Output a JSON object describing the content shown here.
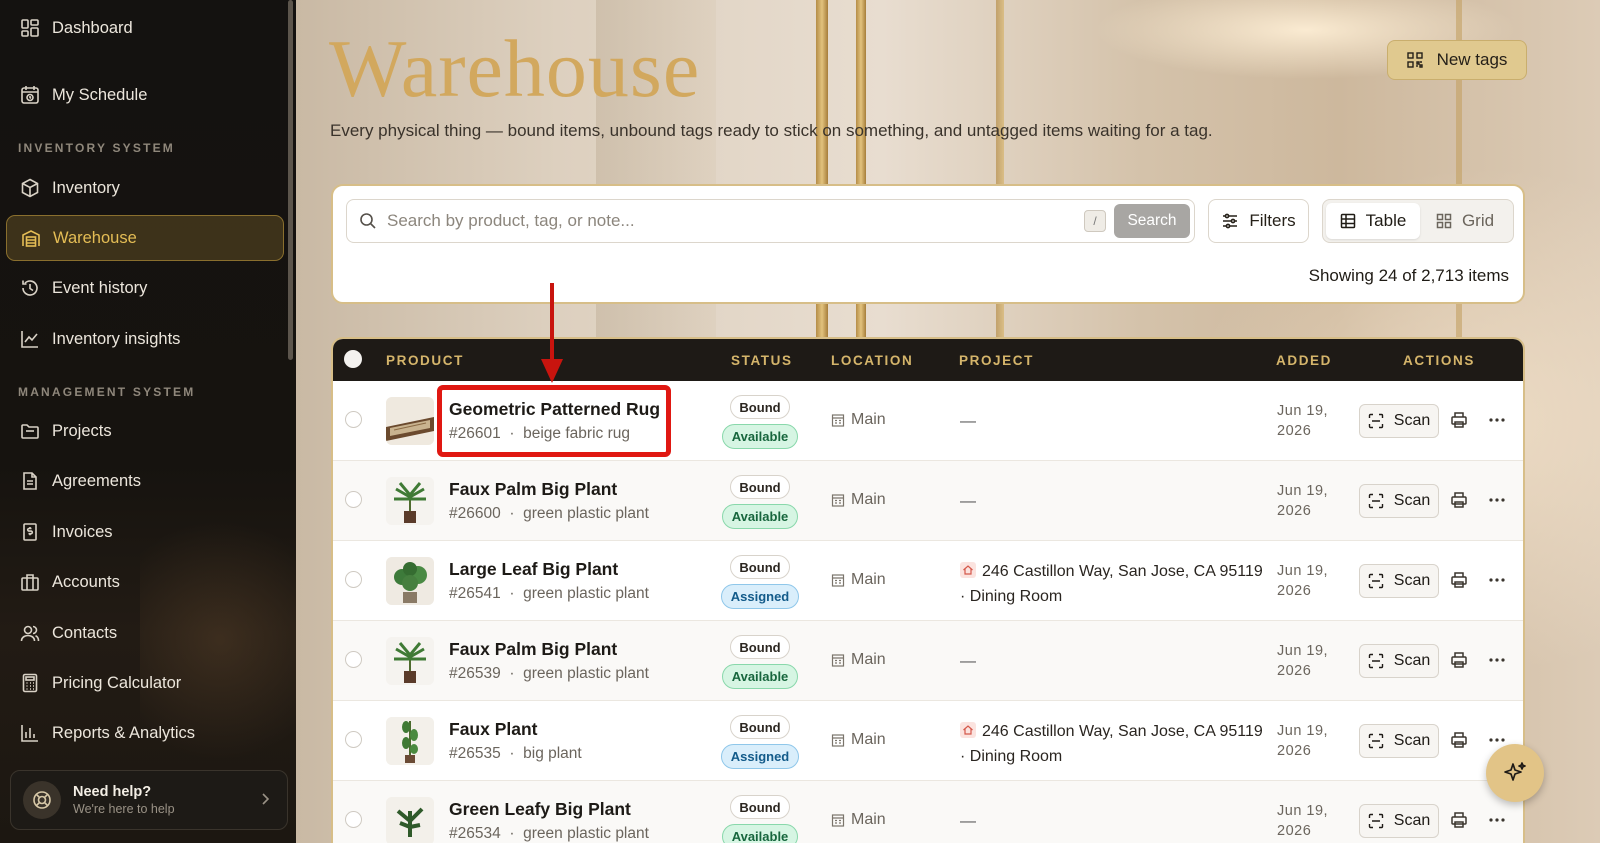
{
  "sidebar": {
    "top_items": [
      {
        "label": "Dashboard",
        "icon": "dashboard-icon"
      },
      {
        "label": "My Schedule",
        "icon": "calendar-clock-icon"
      }
    ],
    "sections": [
      {
        "title": "INVENTORY SYSTEM",
        "items": [
          {
            "label": "Inventory",
            "icon": "cube-icon"
          },
          {
            "label": "Warehouse",
            "icon": "warehouse-icon",
            "active": true
          },
          {
            "label": "Event history",
            "icon": "history-icon"
          },
          {
            "label": "Inventory insights",
            "icon": "chart-line-icon"
          }
        ]
      },
      {
        "title": "MANAGEMENT SYSTEM",
        "items": [
          {
            "label": "Projects",
            "icon": "folder-icon"
          },
          {
            "label": "Agreements",
            "icon": "document-icon"
          },
          {
            "label": "Invoices",
            "icon": "invoice-icon"
          },
          {
            "label": "Accounts",
            "icon": "briefcase-icon"
          },
          {
            "label": "Contacts",
            "icon": "users-icon"
          },
          {
            "label": "Pricing Calculator",
            "icon": "calculator-icon"
          },
          {
            "label": "Reports & Analytics",
            "icon": "bar-chart-icon"
          }
        ]
      }
    ],
    "help": {
      "title": "Need help?",
      "subtitle": "We're here to help"
    }
  },
  "header": {
    "title": "Warehouse",
    "subtitle": "Every physical thing — bound items, unbound tags ready to stick on something, and untagged items waiting for a tag.",
    "new_tags_label": "New tags"
  },
  "search": {
    "placeholder": "Search by product, tag, or note...",
    "shortcut": "/",
    "button_label": "Search",
    "filters_label": "Filters",
    "view_table_label": "Table",
    "view_grid_label": "Grid",
    "showing": "Showing 24 of 2,713 items"
  },
  "table": {
    "columns": {
      "product": "PRODUCT",
      "status": "STATUS",
      "location": "LOCATION",
      "project": "PROJECT",
      "added": "ADDED",
      "actions": "ACTIONS"
    },
    "scan_label": "Scan",
    "rows": [
      {
        "name": "Geometric Patterned Rug",
        "id": "#26601",
        "desc": "beige fabric rug",
        "tag": "Bound",
        "status": "Available",
        "status_type": "available",
        "location": "Main",
        "project_line1": "—",
        "project_line2": "",
        "added_line1": "Jun 19,",
        "added_line2": "2026",
        "thumb": "rug"
      },
      {
        "name": "Faux Palm Big Plant",
        "id": "#26600",
        "desc": "green plastic plant",
        "tag": "Bound",
        "status": "Available",
        "status_type": "available",
        "location": "Main",
        "project_line1": "—",
        "project_line2": "",
        "added_line1": "Jun 19,",
        "added_line2": "2026",
        "thumb": "palm"
      },
      {
        "name": "Large Leaf Big Plant",
        "id": "#26541",
        "desc": "green plastic plant",
        "tag": "Bound",
        "status": "Assigned",
        "status_type": "assigned",
        "location": "Main",
        "project_line1": "246 Castillon Way, San Jose, CA 95119",
        "project_line2": "· Dining Room",
        "added_line1": "Jun 19,",
        "added_line2": "2026",
        "thumb": "leaf"
      },
      {
        "name": "Faux Palm Big Plant",
        "id": "#26539",
        "desc": "green plastic plant",
        "tag": "Bound",
        "status": "Available",
        "status_type": "available",
        "location": "Main",
        "project_line1": "—",
        "project_line2": "",
        "added_line1": "Jun 19,",
        "added_line2": "2026",
        "thumb": "palm"
      },
      {
        "name": "Faux Plant",
        "id": "#26535",
        "desc": "big plant",
        "tag": "Bound",
        "status": "Assigned",
        "status_type": "assigned",
        "location": "Main",
        "project_line1": "246 Castillon Way, San Jose, CA 95119",
        "project_line2": "· Dining Room",
        "added_line1": "Jun 19,",
        "added_line2": "2026",
        "thumb": "tall"
      },
      {
        "name": "Green Leafy Big Plant",
        "id": "#26534",
        "desc": "green plastic plant",
        "tag": "Bound",
        "status": "Available",
        "status_type": "available",
        "location": "Main",
        "project_line1": "—",
        "project_line2": "",
        "added_line1": "Jun 19,",
        "added_line2": "2026",
        "thumb": "leafy"
      }
    ]
  },
  "colors": {
    "accent_gold": "#d2a85e",
    "highlight_red": "#e01812",
    "available_green": "#17663d",
    "assigned_blue": "#135b8a"
  }
}
